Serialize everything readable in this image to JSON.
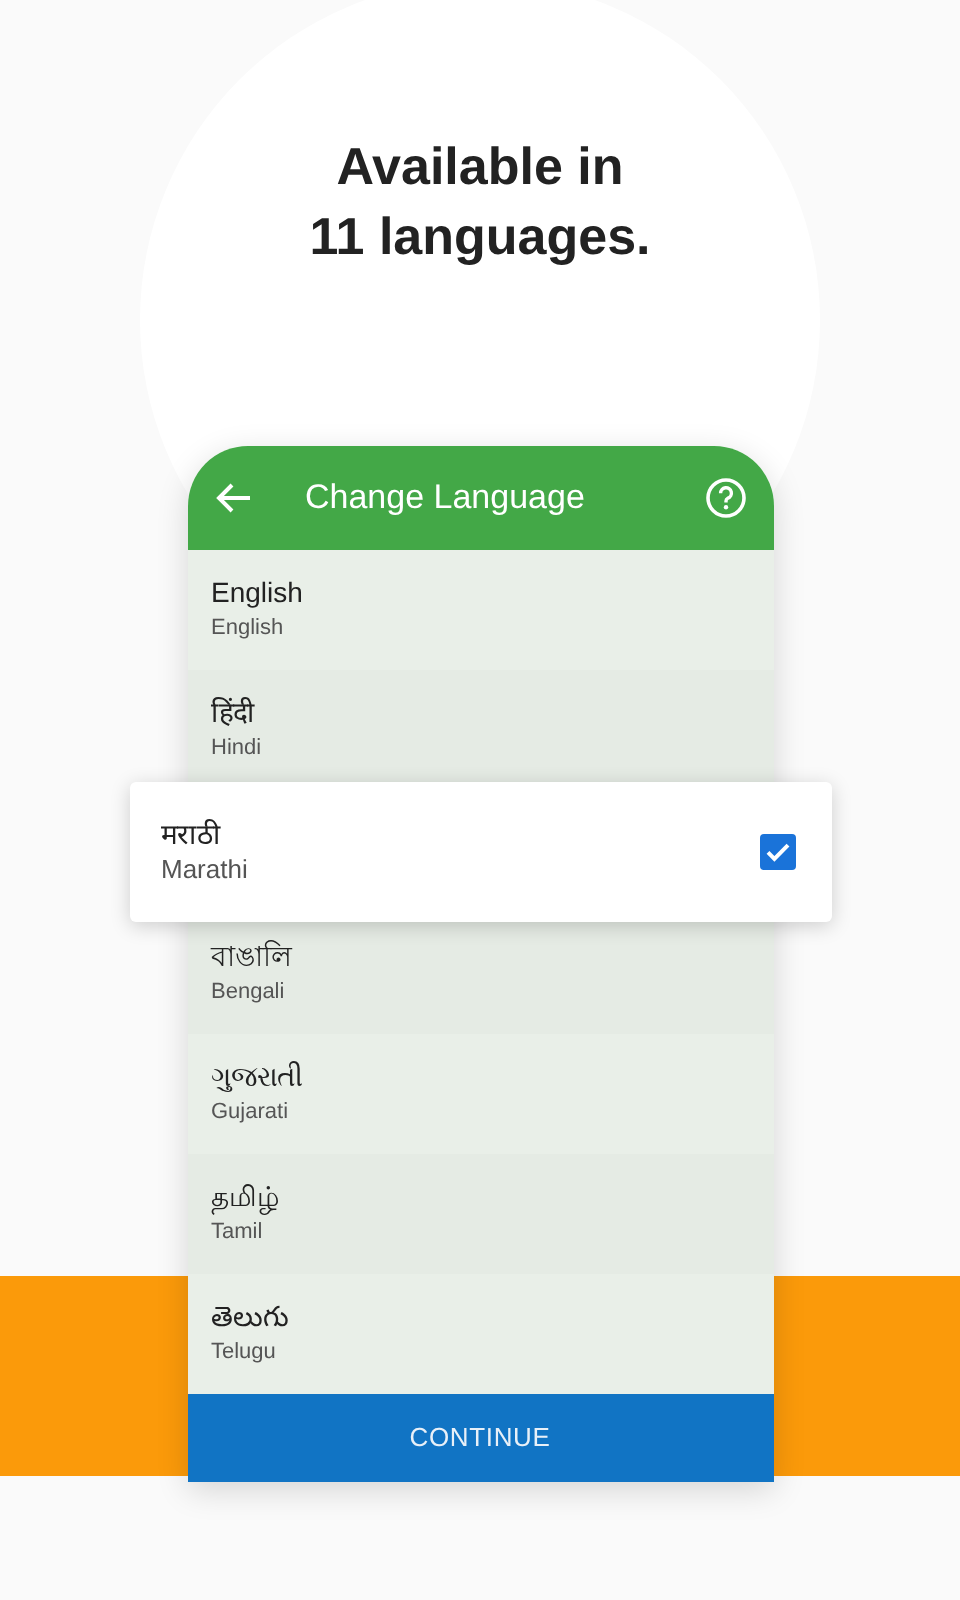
{
  "headline": [
    "Available in",
    "11 languages."
  ],
  "app_bar": {
    "title": "Change Language"
  },
  "languages": [
    {
      "native": "English",
      "name": "English",
      "selected": false
    },
    {
      "native": "हिंदी",
      "name": "Hindi",
      "selected": false
    },
    {
      "native": "मराठी",
      "name": "Marathi",
      "selected": true
    },
    {
      "native": "বাঙালি",
      "name": "Bengali",
      "selected": false
    },
    {
      "native": "ગુજરાતી",
      "name": "Gujarati",
      "selected": false
    },
    {
      "native": "தமிழ்",
      "name": "Tamil",
      "selected": false
    },
    {
      "native": "తెలుగు",
      "name": "Telugu",
      "selected": false
    }
  ],
  "continue_button": "CONTINUE"
}
